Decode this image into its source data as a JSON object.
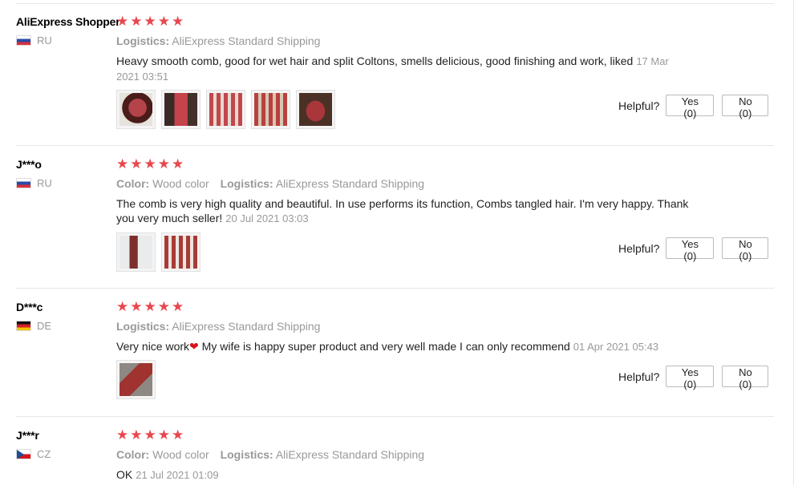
{
  "labels": {
    "logistics": "Logistics:",
    "color": "Color:",
    "helpful": "Helpful?",
    "yes": "Yes (0)",
    "no": "No (0)"
  },
  "star_color": "#e8474e",
  "reviews": [
    {
      "user": "AliExpress Shopper",
      "country": "RU",
      "stars": 5,
      "logistics": "AliExpress Standard Shipping",
      "text": "Heavy smooth comb, good for wet hair and split Coltons, smells delicious, good finishing and work, liked",
      "date": "17 Mar 2021 03:51",
      "photos": 5
    },
    {
      "user": "J***o",
      "country": "RU",
      "stars": 5,
      "color": "Wood color",
      "logistics": "AliExpress Standard Shipping",
      "text": "The comb is very high quality and beautiful. In use performs its function, Combs tangled hair. I'm very happy. Thank you very much seller!",
      "date": "20 Jul 2021 03:03",
      "photos": 2
    },
    {
      "user": "D***c",
      "country": "DE",
      "stars": 5,
      "logistics": "AliExpress Standard Shipping",
      "text_before": "Very nice work",
      "heart": "❤",
      "text_after": " My wife is happy super product and very well made I can only recommend",
      "date": "01 Apr 2021 05:43",
      "photos": 1
    },
    {
      "user": "J***r",
      "country": "CZ",
      "stars": 5,
      "color": "Wood color",
      "logistics": "AliExpress Standard Shipping",
      "text": "OK",
      "date": "21 Jul 2021 01:09",
      "photos": 0
    }
  ]
}
